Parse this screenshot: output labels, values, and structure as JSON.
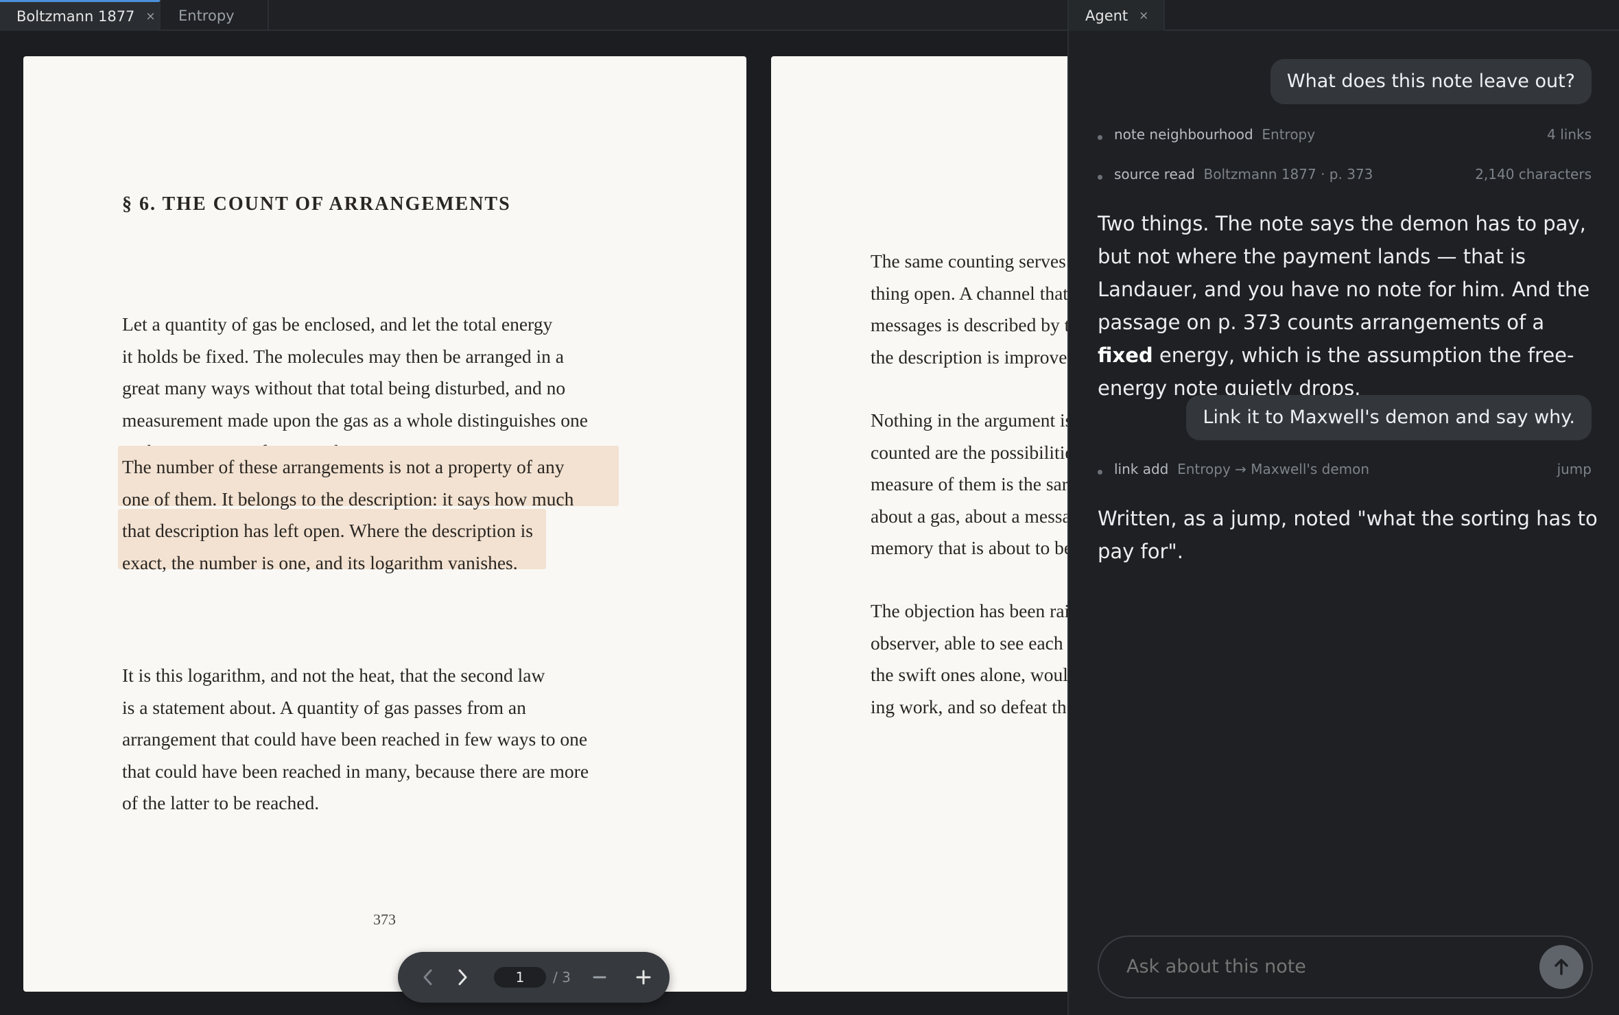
{
  "viewer": {
    "tabs": [
      {
        "label": "Boltzmann 1877",
        "close": "×"
      },
      {
        "label": "Entropy"
      }
    ],
    "page1": {
      "heading": "§ 6. THE COUNT OF ARRANGEMENTS",
      "para1": [
        "Let a quantity of gas be enclosed, and let the total energy",
        "it holds be fixed. The molecules may then be arranged in a",
        "great many ways without that total being disturbed, and no",
        "measurement made upon the gas as a whole distinguishes one",
        "such arrangement from another."
      ],
      "para2": [
        "The number of these arrangements is not a property of any",
        "one of them. It belongs to the description: it says how much",
        "that description has left open. Where the description is",
        "exact, the number is one, and its logarithm vanishes."
      ],
      "para3": [
        "It is this logarithm, and not the heat, that the second law",
        "is a statement about. A quantity of gas passes from an",
        "arrangement that could have been reached in few ways to one",
        "that could have been reached in many, because there are more",
        "of the latter to be reached."
      ],
      "page_number": "373"
    },
    "page2": {
      "para1": [
        "The same counting serves",
        "thing open. A channel that",
        "messages is described by t",
        "the description is improve"
      ],
      "para2": [
        "Nothing in the argument is",
        "counted are the possibilitie",
        "measure of them is the sar",
        "about a gas, about a messa",
        "memory that is about to be"
      ],
      "para3": [
        "The objection has been rai",
        "observer, able to see each",
        "the swift ones alone, woul",
        "ing work, and so defeat th"
      ]
    },
    "pager": {
      "current_page": "1",
      "total": "/ 3"
    }
  },
  "agent": {
    "tab": {
      "label": "Agent",
      "close": "×"
    },
    "messages": {
      "user1": "What does this note leave out?",
      "tool1": {
        "name": "note neighbourhood",
        "detail": "Entropy",
        "meta": "4 links"
      },
      "tool2": {
        "name": "source read",
        "detail": "Boltzmann 1877 · p. 373",
        "meta": "2,140 characters"
      },
      "answer1_a": "Two things. The note says the demon has to pay, but not where the payment lands — that is Landauer, and you have no note for him. And the passage on p. 373 counts arrangements of a ",
      "answer1_bold": "fixed",
      "answer1_b": " energy, which is the assumption the free-energy note quietly drops.",
      "user2": "Link it to Maxwell's demon and say why.",
      "tool3": {
        "name": "link add",
        "detail": "Entropy → Maxwell's demon",
        "meta": "jump"
      },
      "answer2": "Written, as a jump, noted \"what the sorting has to pay for\"."
    },
    "composer": {
      "placeholder": "Ask about this note"
    }
  },
  "colors": {
    "accent": "#4a90d9",
    "highlight": "#f3e2d1",
    "page": "#faf8f5",
    "panel": "#1e2023"
  }
}
